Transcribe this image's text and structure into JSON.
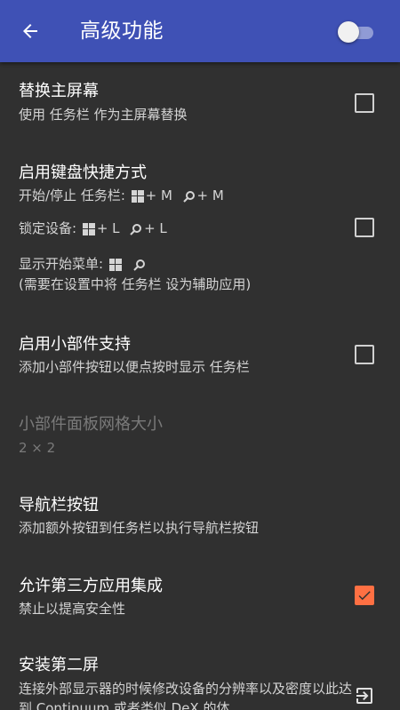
{
  "appbar": {
    "title": "高级功能",
    "back_icon": "arrow-left-icon",
    "master_switch_on": false
  },
  "settings": {
    "replace_home": {
      "title": "替换主屏幕",
      "summary": "使用 任务栏 作为主屏幕替换",
      "checked": false
    },
    "keyboard_shortcuts": {
      "title": "启用键盘快捷方式",
      "line1_prefix": "开始/停止 任务栏:",
      "line1_key1": "+ M",
      "line1_key2": "+ M",
      "line2_prefix": "锁定设备:",
      "line2_key1": "+ L",
      "line2_key2": "+ L",
      "line3_prefix": "显示开始菜单:",
      "line4": "(需要在设置中将 任务栏 设为辅助应用)",
      "checked": false
    },
    "widgets": {
      "title": "启用小部件支持",
      "summary": "添加小部件按钮以便点按时显示 任务栏",
      "checked": false
    },
    "widget_grid": {
      "title": "小部件面板网格大小",
      "value": "2 × 2"
    },
    "nav_buttons": {
      "title": "导航栏按钮",
      "summary": "添加额外按钮到任务栏以执行导航栏按钮"
    },
    "third_party": {
      "title": "允许第三方应用集成",
      "summary": "禁止以提高安全性",
      "checked": true
    },
    "second_screen": {
      "title": "安装第二屏",
      "summary": "连接外部显示器的时候修改设备的分辨率以及密度以此达到 Continuum 或者类似 DeX 的体"
    }
  },
  "colors": {
    "appbar": "#3f51b5",
    "background": "#303030",
    "accent": "#ff7043"
  }
}
